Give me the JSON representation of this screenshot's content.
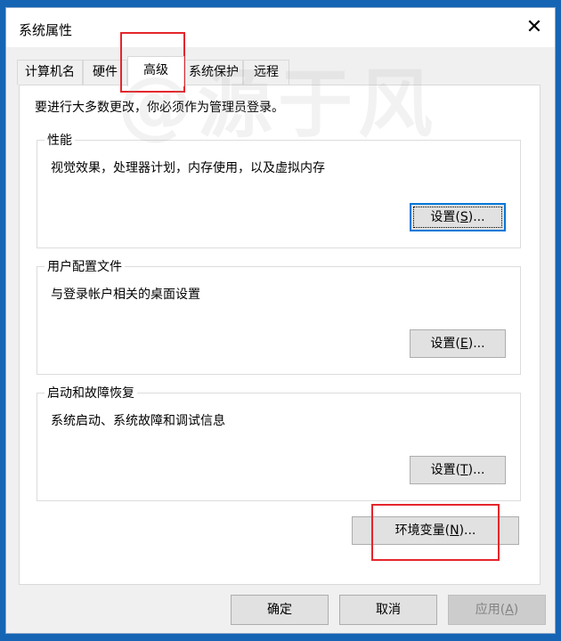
{
  "window": {
    "title": "系统属性"
  },
  "tabs": [
    {
      "label": "计算机名"
    },
    {
      "label": "硬件"
    },
    {
      "label": "高级"
    },
    {
      "label": "系统保护"
    },
    {
      "label": "远程"
    }
  ],
  "intro": "要进行大多数更改，你必须作为管理员登录。",
  "groups": [
    {
      "title": "性能",
      "desc": "视觉效果，处理器计划，内存使用，以及虚拟内存",
      "btn_pre": "设置(",
      "btn_key": "S",
      "btn_post": ")..."
    },
    {
      "title": "用户配置文件",
      "desc": "与登录帐户相关的桌面设置",
      "btn_pre": "设置(",
      "btn_key": "E",
      "btn_post": ")..."
    },
    {
      "title": "启动和故障恢复",
      "desc": "系统启动、系统故障和调试信息",
      "btn_pre": "设置(",
      "btn_key": "T",
      "btn_post": ")..."
    }
  ],
  "env_button": {
    "pre": "环境变量(",
    "key": "N",
    "post": ")..."
  },
  "footer": {
    "ok": "确定",
    "cancel": "取消",
    "apply_pre": "应用(",
    "apply_key": "A",
    "apply_post": ")"
  },
  "watermark": "@源于风",
  "colors": {
    "highlight_box": "#e4262c",
    "focus": "#0078d7",
    "desktop": "#1565b4"
  }
}
